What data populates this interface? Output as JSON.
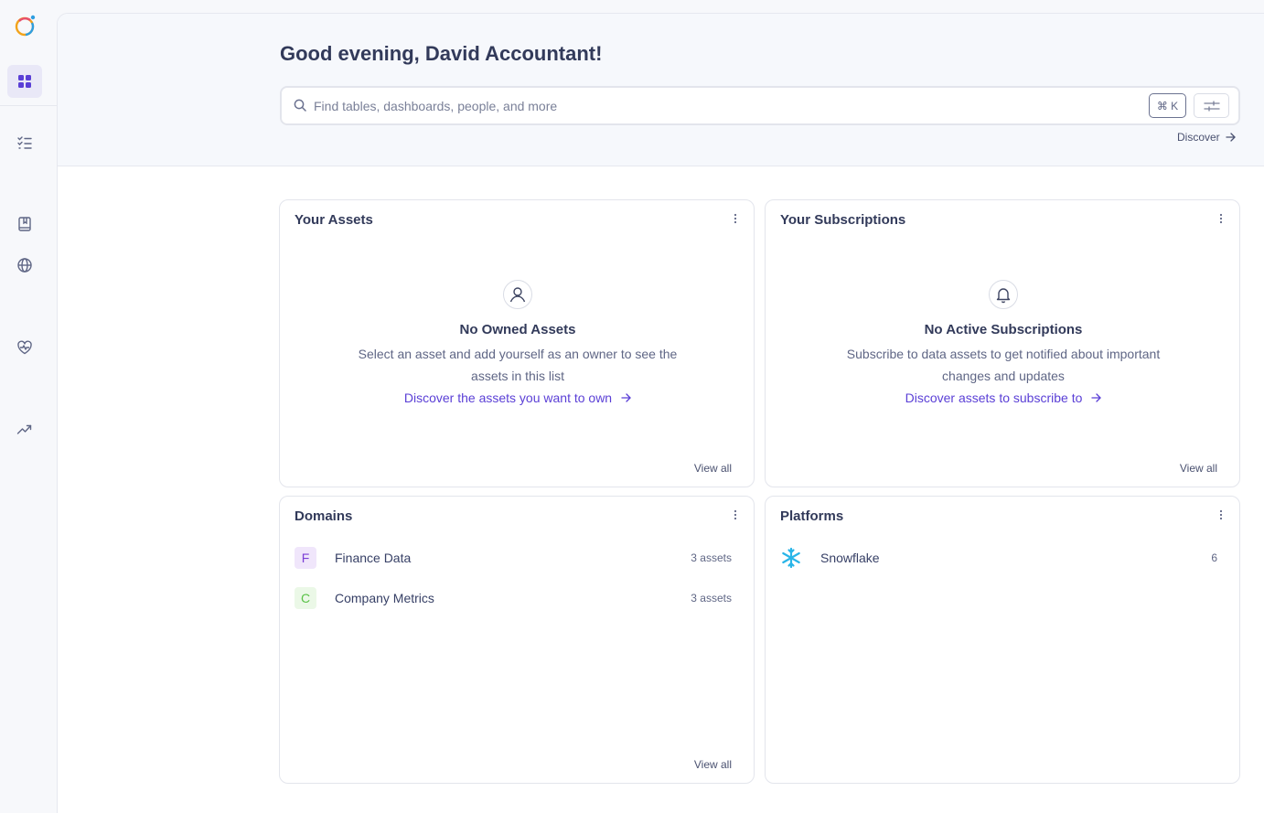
{
  "sidebar": {
    "logo": "datahub-logo",
    "items": [
      {
        "icon": "grid-icon",
        "active": true
      },
      {
        "icon": "task-list-icon"
      },
      {
        "icon": "glossary-book-icon"
      },
      {
        "icon": "globe-icon"
      },
      {
        "icon": "health-heart-icon"
      },
      {
        "icon": "trending-chart-icon"
      }
    ]
  },
  "header": {
    "greeting": "Good evening, David Accountant!",
    "search_placeholder": "Find tables, dashboards, people, and more",
    "shortcut": "⌘ K",
    "discover_label": "Discover"
  },
  "cards": {
    "assets": {
      "title": "Your Assets",
      "empty_title": "No Owned Assets",
      "empty_desc": "Select an asset and add yourself as an owner to see the assets in this list",
      "link": "Discover the assets you want to own",
      "view_all": "View all"
    },
    "subscriptions": {
      "title": "Your Subscriptions",
      "empty_title": "No Active Subscriptions",
      "empty_desc": "Subscribe to data assets to get notified about important changes and updates",
      "link": "Discover assets to subscribe to",
      "view_all": "View all"
    },
    "domains": {
      "title": "Domains",
      "items": [
        {
          "letter": "F",
          "name": "Finance Data",
          "count": "3 assets",
          "color": "#7b3fd6",
          "bg": "#f0e6fb"
        },
        {
          "letter": "C",
          "name": "Company Metrics",
          "count": "3 assets",
          "color": "#59c246",
          "bg": "#ebf8e7"
        }
      ],
      "view_all": "View all"
    },
    "platforms": {
      "title": "Platforms",
      "items": [
        {
          "name": "Snowflake",
          "count": "6",
          "icon": "snowflake-icon",
          "color": "#29b5e8"
        }
      ]
    }
  },
  "colors": {
    "accent": "#5a3fd6",
    "text": "#374066"
  }
}
